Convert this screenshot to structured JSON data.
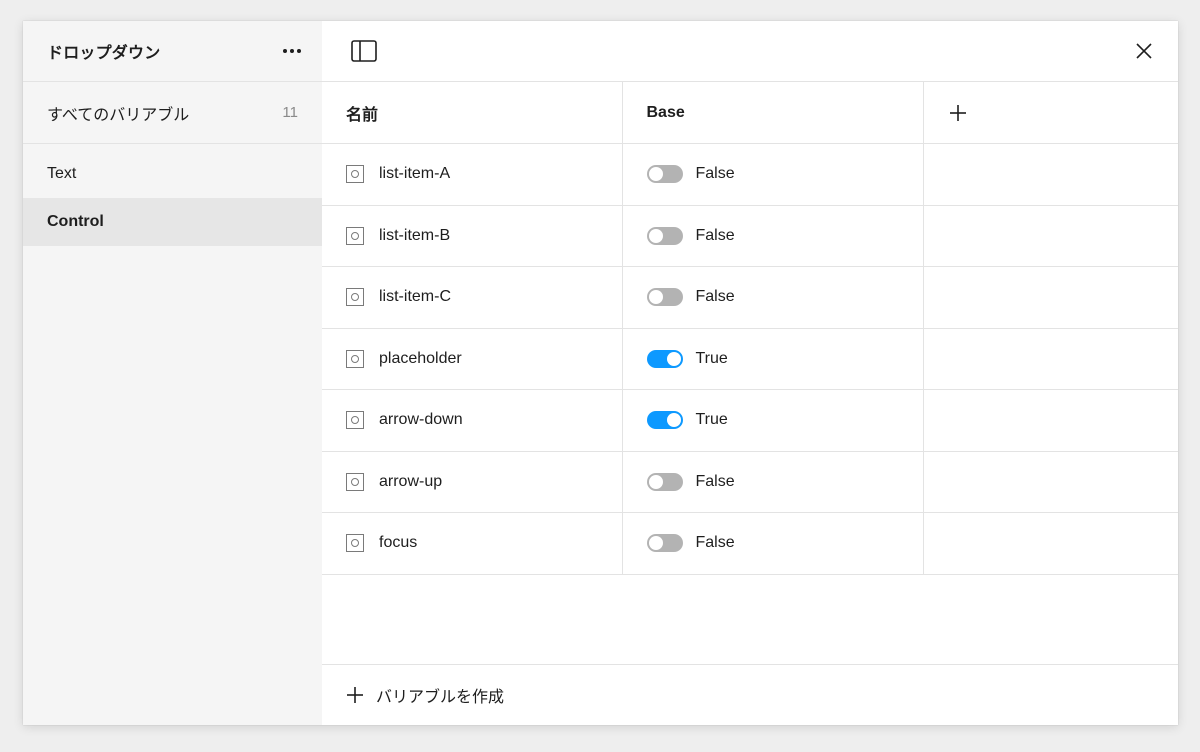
{
  "sidebar": {
    "title": "ドロップダウン",
    "all_variables": {
      "label": "すべてのバリアブル",
      "count": "11"
    },
    "groups": [
      {
        "label": "Text",
        "selected": false
      },
      {
        "label": "Control",
        "selected": true
      }
    ]
  },
  "table": {
    "headers": {
      "name": "名前",
      "mode": "Base"
    },
    "rows": [
      {
        "name": "list-item-A",
        "value": "False",
        "on": false
      },
      {
        "name": "list-item-B",
        "value": "False",
        "on": false
      },
      {
        "name": "list-item-C",
        "value": "False",
        "on": false
      },
      {
        "name": "placeholder",
        "value": "True",
        "on": true
      },
      {
        "name": "arrow-down",
        "value": "True",
        "on": true
      },
      {
        "name": "arrow-up",
        "value": "False",
        "on": false
      },
      {
        "name": "focus",
        "value": "False",
        "on": false
      }
    ]
  },
  "footer": {
    "create_label": "バリアブルを作成"
  },
  "icons": {
    "more": "more-horizontal-icon",
    "sidebar_toggle": "sidebar-panel-icon",
    "close": "close-icon",
    "add_mode": "plus-icon",
    "variable": "boolean-variable-icon",
    "create": "plus-icon"
  },
  "colors": {
    "toggle_on": "#0d99ff",
    "toggle_off": "#b3b3b3",
    "sidebar_bg": "#f5f5f5",
    "selected_bg": "#e6e6e6"
  }
}
